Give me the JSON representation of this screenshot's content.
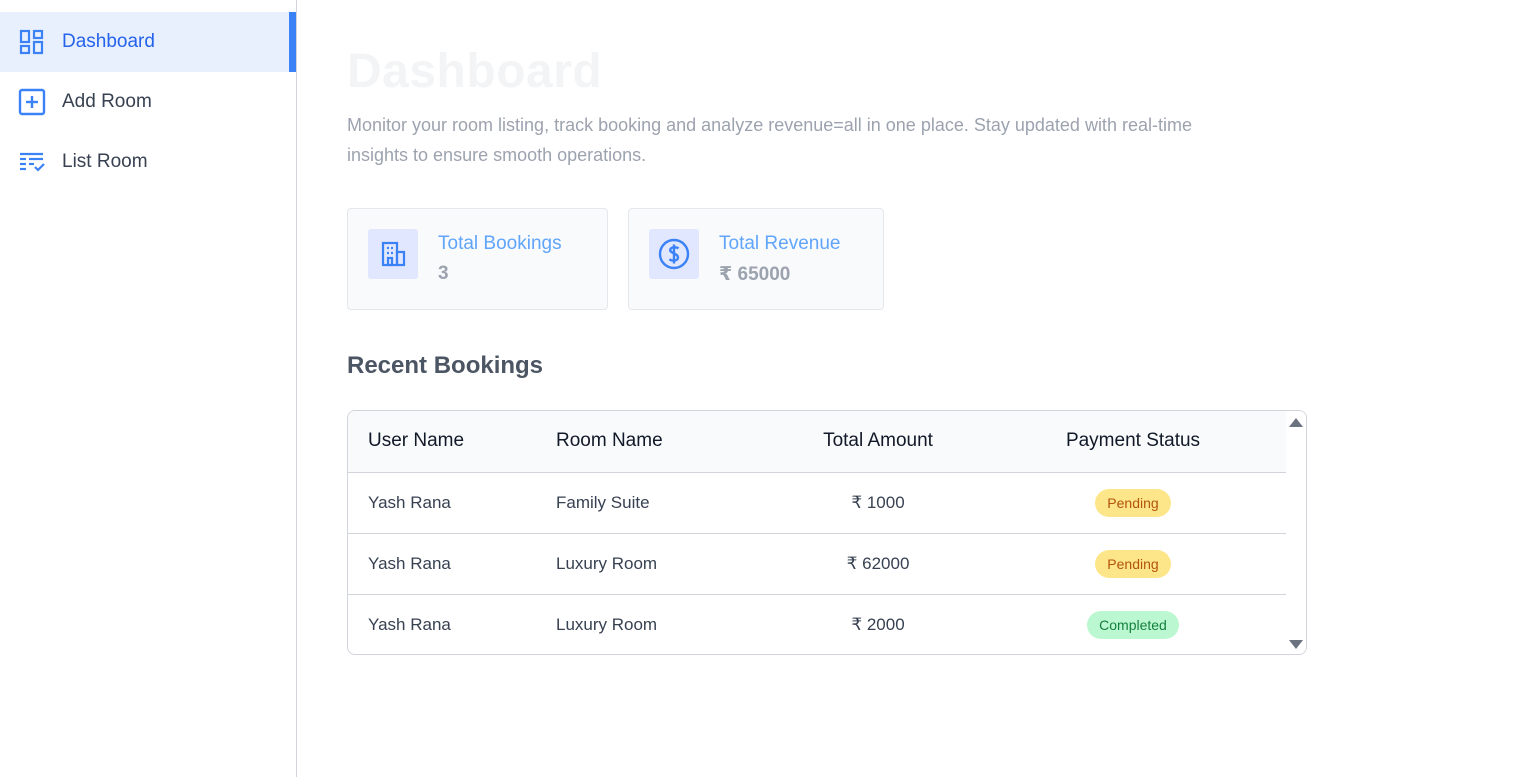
{
  "sidebar": {
    "items": [
      {
        "label": "Dashboard",
        "icon": "dashboard-icon",
        "active": true
      },
      {
        "label": "Add Room",
        "icon": "add-square-icon",
        "active": false
      },
      {
        "label": "List Room",
        "icon": "list-check-icon",
        "active": false
      }
    ]
  },
  "main": {
    "title": "Dashboard",
    "description": "Monitor your room listing, track booking and analyze revenue=all in one place. Stay updated with real-time insights to ensure smooth operations.",
    "stats": [
      {
        "title": "Total Bookings",
        "value": "3",
        "icon": "building-icon"
      },
      {
        "title": "Total Revenue",
        "value": "₹ 65000",
        "icon": "dollar-circle-icon"
      }
    ],
    "recent_title": "Recent Bookings",
    "table": {
      "headers": [
        "User Name",
        "Room Name",
        "Total Amount",
        "Payment Status"
      ],
      "rows": [
        {
          "user": "Yash Rana",
          "room": "Family Suite",
          "amount": "₹ 1000",
          "status": "Pending"
        },
        {
          "user": "Yash Rana",
          "room": "Luxury Room",
          "amount": "₹ 62000",
          "status": "Pending"
        },
        {
          "user": "Yash Rana",
          "room": "Luxury Room",
          "amount": "₹ 2000",
          "status": "Completed"
        }
      ]
    }
  },
  "colors": {
    "accent": "#3b82f6",
    "active_bg": "#e8f0fe",
    "pending_bg": "#fde68a",
    "completed_bg": "#bbf7d0"
  }
}
